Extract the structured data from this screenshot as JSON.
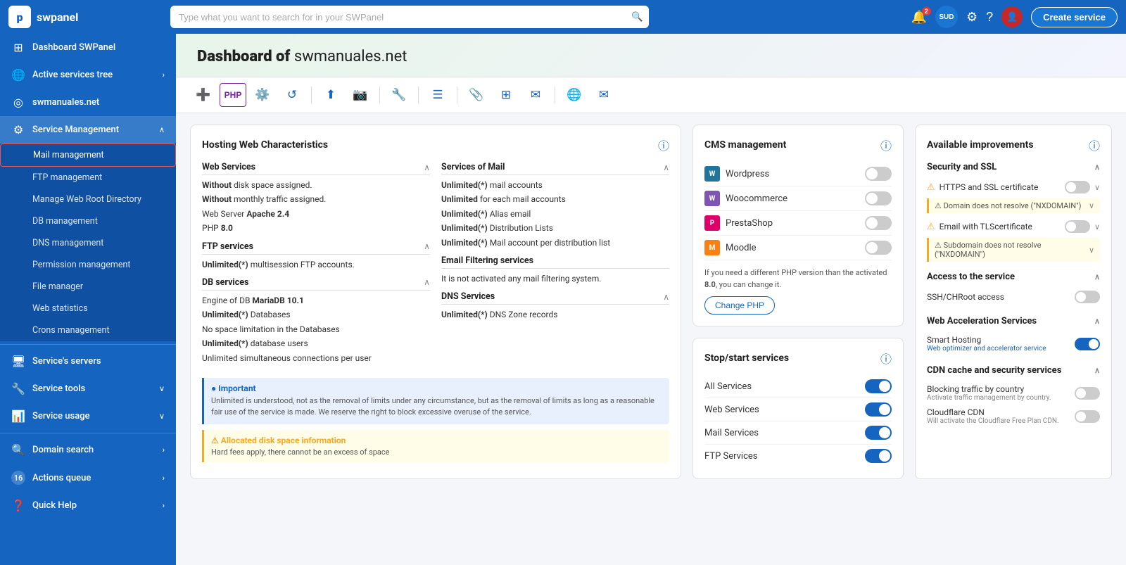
{
  "topbar": {
    "logo_text": "swpanel",
    "logo_letter": "p",
    "search_placeholder": "Type what you want to search for in your SWPanel",
    "notifications_badge": "2",
    "support_badge": "SUD",
    "create_service_label": "Create service"
  },
  "sidebar": {
    "items": [
      {
        "id": "dashboard",
        "label": "Dashboard SWPanel",
        "icon": "⊞",
        "has_chevron": false
      },
      {
        "id": "active-services-tree",
        "label": "Active services tree",
        "icon": "🌐",
        "has_chevron": true
      },
      {
        "id": "swmanuales",
        "label": "swmanuales.net",
        "icon": "◎",
        "has_chevron": false
      },
      {
        "id": "service-management",
        "label": "Service Management",
        "icon": "⚙",
        "has_chevron": true,
        "expanded": true
      }
    ],
    "sub_items": [
      {
        "id": "mail-management",
        "label": "Mail management",
        "active": true
      },
      {
        "id": "ftp-management",
        "label": "FTP management"
      },
      {
        "id": "manage-web-root",
        "label": "Manage Web Root Directory"
      },
      {
        "id": "db-management",
        "label": "DB management"
      },
      {
        "id": "dns-management",
        "label": "DNS management"
      },
      {
        "id": "permission-management",
        "label": "Permission management"
      },
      {
        "id": "file-manager",
        "label": "File manager"
      },
      {
        "id": "web-statistics",
        "label": "Web statistics"
      },
      {
        "id": "crons-management",
        "label": "Crons management"
      }
    ],
    "bottom_items": [
      {
        "id": "services-servers",
        "label": "Service's servers",
        "icon": "🖥",
        "has_chevron": false
      },
      {
        "id": "service-tools",
        "label": "Service tools",
        "icon": "🔧",
        "has_chevron": true
      },
      {
        "id": "service-usage",
        "label": "Service usage",
        "icon": "📊",
        "has_chevron": true
      },
      {
        "id": "domain-search",
        "label": "Domain search",
        "icon": "🔍",
        "has_chevron": true
      },
      {
        "id": "actions-queue",
        "label": "Actions queue",
        "icon": "16",
        "has_chevron": true
      },
      {
        "id": "quick-help",
        "label": "Quick Help",
        "icon": "❓",
        "has_chevron": true
      }
    ]
  },
  "page": {
    "title": "Dashboard of",
    "domain": "swmanuales.net"
  },
  "toolbar": {
    "buttons": [
      "➕",
      "PHP",
      "⚙",
      "↺",
      "⬆",
      "📷",
      "🔧",
      "|",
      "☰",
      "|",
      "📎",
      "⊞",
      "✉",
      "|",
      "🌐",
      "✉"
    ]
  },
  "hosting": {
    "card_title": "Hosting Web Characteristics",
    "web_services": {
      "title": "Web Services",
      "rows": [
        "Without disk space assigned.",
        "Without monthly traffic assigned.",
        "Web Server Apache 2.4",
        "PHP 8.0"
      ]
    },
    "ftp_services": {
      "title": "FTP services",
      "rows": [
        "Unlimited(*) multisession FTP accounts."
      ]
    },
    "db_services": {
      "title": "DB services",
      "rows": [
        "Engine of DB MariaDB 10.1",
        "Unlimited(*) Databases",
        "No space limitation in the Databases",
        "Unlimited(*) database users",
        "Unlimited simultaneous connections per user"
      ]
    },
    "mail_services": {
      "title": "Services of Mail",
      "rows": [
        "Unlimited(*) mail accounts",
        "Unlimited for each mail accounts",
        "Unlimited(*) Alias email",
        "Unlimited(*) Distribution Lists",
        "Unlimited(*) Mail account per distribution list"
      ]
    },
    "email_filtering": {
      "title": "Email Filtering services",
      "rows": [
        "It is not activated any mail filtering system."
      ]
    },
    "dns_services": {
      "title": "DNS Services",
      "rows": [
        "Unlimited(*) DNS Zone records"
      ]
    },
    "important": {
      "title": "Important",
      "text": "Unlimited is understood, not as the removal of limits under any circumstance, but as the removal of limits as long as a reasonable fair use of the service is made. We reserve the right to block excessive overuse of the service."
    },
    "warning": {
      "title": "Allocated disk space information",
      "text": "Hard fees apply, there cannot be an excess of space"
    }
  },
  "cms": {
    "card_title": "CMS management",
    "items": [
      {
        "name": "Wordpress",
        "logo": "WP",
        "type": "wp",
        "enabled": false
      },
      {
        "name": "Woocommerce",
        "logo": "WC",
        "type": "woo",
        "enabled": false
      },
      {
        "name": "PrestaShop",
        "logo": "PS",
        "type": "pres",
        "enabled": false
      },
      {
        "name": "Moodle",
        "logo": "M",
        "type": "moo",
        "enabled": false
      }
    ],
    "note": "If you need a different PHP version than the activated 8.0, you can change it.",
    "php_bold": "8.0",
    "change_php_label": "Change PHP"
  },
  "stop_start": {
    "card_title": "Stop/start services",
    "items": [
      {
        "label": "All Services",
        "enabled": true
      },
      {
        "label": "Web Services",
        "enabled": true
      },
      {
        "label": "Mail Services",
        "enabled": true
      },
      {
        "label": "FTP Services",
        "enabled": true
      }
    ]
  },
  "improvements": {
    "card_title": "Available improvements",
    "security_ssl": {
      "title": "Security and SSL",
      "items": [
        {
          "label": "HTTPS and SSL certificate",
          "warning": true,
          "enabled": false,
          "has_dropdown": true
        },
        {
          "warning_text": "Domain does not resolve (\"NXDOMAIN\")",
          "has_dropdown": true
        },
        {
          "label": "Email with TLScertificate",
          "warning": true,
          "enabled": false,
          "has_dropdown": true
        },
        {
          "warning_text": "Subdomain does not resolve (\"NXDOMAIN\")",
          "has_dropdown": true
        }
      ]
    },
    "access": {
      "title": "Access to the service",
      "items": [
        {
          "label": "SSH/CHRoot access",
          "enabled": false
        }
      ]
    },
    "web_acceleration": {
      "title": "Web Acceleration Services",
      "items": [
        {
          "label": "Smart Hosting",
          "sublabel": "Web optimizer and accelerator service",
          "enabled": true
        }
      ]
    },
    "cdn": {
      "title": "CDN cache and security services",
      "items": [
        {
          "label": "Blocking traffic by country",
          "sublabel": "Activate traffic management by country.",
          "enabled": false
        },
        {
          "label": "Cloudflare CDN",
          "sublabel": "Will activate the Cloudflare Free Plan CDN.",
          "enabled": false
        }
      ]
    }
  }
}
